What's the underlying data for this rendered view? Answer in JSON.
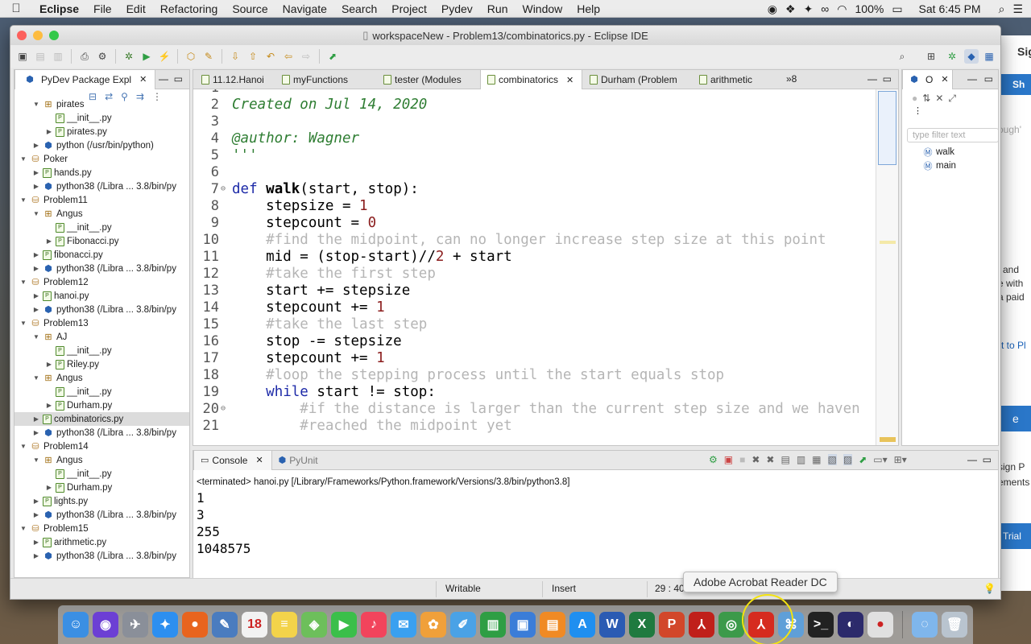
{
  "menubar": {
    "app": "Eclipse",
    "items": [
      "File",
      "Edit",
      "Refactoring",
      "Source",
      "Navigate",
      "Search",
      "Project",
      "Pydev",
      "Run",
      "Window",
      "Help"
    ],
    "battery": "100%",
    "clock": "Sat 6:45 PM"
  },
  "window": {
    "title": "workspaceNew - Problem13/combinatorics.py - Eclipse IDE"
  },
  "background_window": {
    "fragments": [
      "Sig",
      "Sh",
      "ough'",
      "and",
      "e with",
      "a paid",
      "rt to Pl",
      "e",
      "sign P",
      "ements",
      "Trial"
    ]
  },
  "package_explorer": {
    "tab_label": "PyDev Package Expl",
    "rows": [
      {
        "label": "pirates",
        "type": "pkg",
        "indent": 1,
        "arrow": "down"
      },
      {
        "label": "__init__.py",
        "type": "py",
        "indent": 2,
        "arrow": ""
      },
      {
        "label": "pirates.py",
        "type": "py",
        "indent": 2,
        "arrow": "right"
      },
      {
        "label": "python  (/usr/bin/python)",
        "type": "pyi",
        "indent": 1,
        "arrow": "right"
      },
      {
        "label": "Poker",
        "type": "proj",
        "indent": 0,
        "arrow": "down"
      },
      {
        "label": "hands.py",
        "type": "py",
        "indent": 1,
        "arrow": "right"
      },
      {
        "label": "python38  (/Libra ... 3.8/bin/py",
        "type": "pyi",
        "indent": 1,
        "arrow": "right"
      },
      {
        "label": "Problem11",
        "type": "proj",
        "indent": 0,
        "arrow": "down"
      },
      {
        "label": "Angus",
        "type": "pkg",
        "indent": 1,
        "arrow": "down"
      },
      {
        "label": "__init__.py",
        "type": "py",
        "indent": 2,
        "arrow": ""
      },
      {
        "label": "Fibonacci.py",
        "type": "py",
        "indent": 2,
        "arrow": "right"
      },
      {
        "label": "fibonacci.py",
        "type": "py",
        "indent": 1,
        "arrow": "right"
      },
      {
        "label": "python38  (/Libra ... 3.8/bin/py",
        "type": "pyi",
        "indent": 1,
        "arrow": "right"
      },
      {
        "label": "Problem12",
        "type": "proj",
        "indent": 0,
        "arrow": "down"
      },
      {
        "label": "hanoi.py",
        "type": "py",
        "indent": 1,
        "arrow": "right"
      },
      {
        "label": "python38  (/Libra ... 3.8/bin/py",
        "type": "pyi",
        "indent": 1,
        "arrow": "right"
      },
      {
        "label": "Problem13",
        "type": "proj",
        "indent": 0,
        "arrow": "down"
      },
      {
        "label": "AJ",
        "type": "pkg",
        "indent": 1,
        "arrow": "down"
      },
      {
        "label": "__init__.py",
        "type": "py",
        "indent": 2,
        "arrow": ""
      },
      {
        "label": "Riley.py",
        "type": "py",
        "indent": 2,
        "arrow": "right"
      },
      {
        "label": "Angus",
        "type": "pkg",
        "indent": 1,
        "arrow": "down"
      },
      {
        "label": "__init__.py",
        "type": "py",
        "indent": 2,
        "arrow": ""
      },
      {
        "label": "Durham.py",
        "type": "py",
        "indent": 2,
        "arrow": "right"
      },
      {
        "label": "combinatorics.py",
        "type": "py",
        "indent": 1,
        "arrow": "right",
        "selected": true
      },
      {
        "label": "python38  (/Libra ... 3.8/bin/py",
        "type": "pyi",
        "indent": 1,
        "arrow": "right"
      },
      {
        "label": "Problem14",
        "type": "proj",
        "indent": 0,
        "arrow": "down"
      },
      {
        "label": "Angus",
        "type": "pkg",
        "indent": 1,
        "arrow": "down"
      },
      {
        "label": "__init__.py",
        "type": "py",
        "indent": 2,
        "arrow": ""
      },
      {
        "label": "Durham.py",
        "type": "py",
        "indent": 2,
        "arrow": "right"
      },
      {
        "label": "lights.py",
        "type": "py",
        "indent": 1,
        "arrow": "right"
      },
      {
        "label": "python38  (/Libra ... 3.8/bin/py",
        "type": "pyi",
        "indent": 1,
        "arrow": "right"
      },
      {
        "label": "Problem15",
        "type": "proj",
        "indent": 0,
        "arrow": "down"
      },
      {
        "label": "arithmetic.py",
        "type": "py",
        "indent": 1,
        "arrow": "right"
      },
      {
        "label": "python38  (/Libra ... 3.8/bin/py",
        "type": "pyi",
        "indent": 1,
        "arrow": "right"
      }
    ]
  },
  "editor_tabs": [
    {
      "label": "11.12.Hanoi",
      "active": false
    },
    {
      "label": "myFunctions",
      "active": false
    },
    {
      "label": "tester (Modules",
      "active": false
    },
    {
      "label": "combinatorics",
      "active": true
    },
    {
      "label": "Durham (Problem",
      "active": false
    },
    {
      "label": "arithmetic",
      "active": false
    }
  ],
  "editor_overflow": "»8",
  "code_lines": [
    {
      "n": "1",
      "fold": "⊖",
      "parts": [
        {
          "t": "'''",
          "c": "doc"
        }
      ]
    },
    {
      "n": "2",
      "fold": "",
      "parts": [
        {
          "t": "Created on Jul 14, 2020",
          "c": "doc"
        }
      ]
    },
    {
      "n": "3",
      "fold": "",
      "parts": []
    },
    {
      "n": "4",
      "fold": "",
      "parts": [
        {
          "t": "@author: Wagner",
          "c": "doc"
        }
      ]
    },
    {
      "n": "5",
      "fold": "",
      "parts": [
        {
          "t": "'''",
          "c": "doc"
        }
      ]
    },
    {
      "n": "6",
      "fold": "",
      "parts": []
    },
    {
      "n": "7",
      "fold": "⊖",
      "parts": [
        {
          "t": "def ",
          "c": "kw"
        },
        {
          "t": "walk",
          "c": "fn"
        },
        {
          "t": "(start, stop):",
          "c": ""
        }
      ]
    },
    {
      "n": "8",
      "fold": "",
      "parts": [
        {
          "t": "    stepsize = ",
          "c": ""
        },
        {
          "t": "1",
          "c": "num"
        }
      ]
    },
    {
      "n": "9",
      "fold": "",
      "parts": [
        {
          "t": "    stepcount = ",
          "c": ""
        },
        {
          "t": "0",
          "c": "num"
        }
      ]
    },
    {
      "n": "10",
      "fold": "",
      "parts": [
        {
          "t": "    #find the midpoint, can no longer increase step size at this point",
          "c": "cm"
        }
      ]
    },
    {
      "n": "11",
      "fold": "",
      "parts": [
        {
          "t": "    mid = (stop-start)//",
          "c": ""
        },
        {
          "t": "2",
          "c": "num"
        },
        {
          "t": " + start",
          "c": ""
        }
      ]
    },
    {
      "n": "12",
      "fold": "",
      "parts": [
        {
          "t": "    #take the first step",
          "c": "cm"
        }
      ]
    },
    {
      "n": "13",
      "fold": "",
      "parts": [
        {
          "t": "    start += stepsize",
          "c": ""
        }
      ]
    },
    {
      "n": "14",
      "fold": "",
      "parts": [
        {
          "t": "    stepcount += ",
          "c": ""
        },
        {
          "t": "1",
          "c": "num"
        }
      ]
    },
    {
      "n": "15",
      "fold": "",
      "parts": [
        {
          "t": "    #take the last step",
          "c": "cm"
        }
      ]
    },
    {
      "n": "16",
      "fold": "",
      "parts": [
        {
          "t": "    stop -= stepsize",
          "c": ""
        }
      ]
    },
    {
      "n": "17",
      "fold": "",
      "parts": [
        {
          "t": "    stepcount += ",
          "c": ""
        },
        {
          "t": "1",
          "c": "num"
        }
      ]
    },
    {
      "n": "18",
      "fold": "",
      "parts": [
        {
          "t": "    #loop the stepping process until the start equals stop",
          "c": "cm"
        }
      ]
    },
    {
      "n": "19",
      "fold": "",
      "parts": [
        {
          "t": "    ",
          "c": ""
        },
        {
          "t": "while",
          "c": "kw"
        },
        {
          "t": " start != stop:",
          "c": ""
        }
      ]
    },
    {
      "n": "20",
      "fold": "⊖",
      "parts": [
        {
          "t": "        #if the distance is larger than the current step size and we haven",
          "c": "cm"
        }
      ]
    },
    {
      "n": "21",
      "fold": "",
      "parts": [
        {
          "t": "        #reached the midpoint yet",
          "c": "cm"
        }
      ]
    }
  ],
  "outline": {
    "tab_label": "O",
    "filter_placeholder": "type filter text",
    "items": [
      "walk",
      "main"
    ]
  },
  "console": {
    "tabs": [
      "Console",
      "PyUnit"
    ],
    "terminated": "<terminated> hanoi.py [/Library/Frameworks/Python.framework/Versions/3.8/bin/python3.8]",
    "output": [
      "1",
      "3",
      "255",
      "1048575"
    ]
  },
  "statusbar": {
    "writable": "Writable",
    "insert": "Insert",
    "position": "29 : 40"
  },
  "tooltip": "Adobe Acrobat Reader DC",
  "dock": [
    {
      "name": "finder",
      "glyph": "☺",
      "color": "#3b8fe3"
    },
    {
      "name": "siri",
      "glyph": "◉",
      "color": "#6c3fd4"
    },
    {
      "name": "launchpad",
      "glyph": "✈",
      "color": "#8a8f99"
    },
    {
      "name": "safari",
      "glyph": "✦",
      "color": "#2d8ff0"
    },
    {
      "name": "firefox",
      "glyph": "●",
      "color": "#e8641e"
    },
    {
      "name": "preview",
      "glyph": "✎",
      "color": "#4a7cbf"
    },
    {
      "name": "calendar",
      "glyph": "18",
      "color": "#f2f2f2"
    },
    {
      "name": "notes",
      "glyph": "≡",
      "color": "#f3d34a"
    },
    {
      "name": "maps",
      "glyph": "◈",
      "color": "#6dbf5b"
    },
    {
      "name": "facetime",
      "glyph": "▶",
      "color": "#3bbf4a"
    },
    {
      "name": "music",
      "glyph": "♪",
      "color": "#f2445c"
    },
    {
      "name": "messages",
      "glyph": "✉",
      "color": "#3aa0f0"
    },
    {
      "name": "photos",
      "glyph": "✿",
      "color": "#f0a03a"
    },
    {
      "name": "keynote-draw",
      "glyph": "✐",
      "color": "#4aa2e6"
    },
    {
      "name": "numbers",
      "glyph": "▥",
      "color": "#2f9e44"
    },
    {
      "name": "keynote",
      "glyph": "▣",
      "color": "#3b7dd8"
    },
    {
      "name": "books",
      "glyph": "▤",
      "color": "#f08a24"
    },
    {
      "name": "app-store",
      "glyph": "A",
      "color": "#1f8ff0"
    },
    {
      "name": "word",
      "glyph": "W",
      "color": "#2b5bb3"
    },
    {
      "name": "excel",
      "glyph": "X",
      "color": "#1f7a3f"
    },
    {
      "name": "powerpoint",
      "glyph": "P",
      "color": "#d2472a"
    },
    {
      "name": "acrobat",
      "glyph": "⅄",
      "color": "#c0201a"
    },
    {
      "name": "chrome",
      "glyph": "◎",
      "color": "#3c9a4a"
    },
    {
      "name": "acrobat-reader",
      "glyph": "⅄",
      "color": "#d62b1f"
    },
    {
      "name": "utility",
      "glyph": "⌘",
      "color": "#5f9fd8"
    },
    {
      "name": "terminal",
      "glyph": ">_",
      "color": "#222222"
    },
    {
      "name": "eclipse",
      "glyph": "◐",
      "color": "#2c2a6b"
    },
    {
      "name": "recorder",
      "glyph": "●",
      "color": "#e0e0e0"
    }
  ],
  "dock_right": [
    {
      "name": "downloads",
      "glyph": "◌",
      "color": "#7fb6ec"
    },
    {
      "name": "trash",
      "glyph": "🗑",
      "color": "#b9c4cf"
    }
  ]
}
